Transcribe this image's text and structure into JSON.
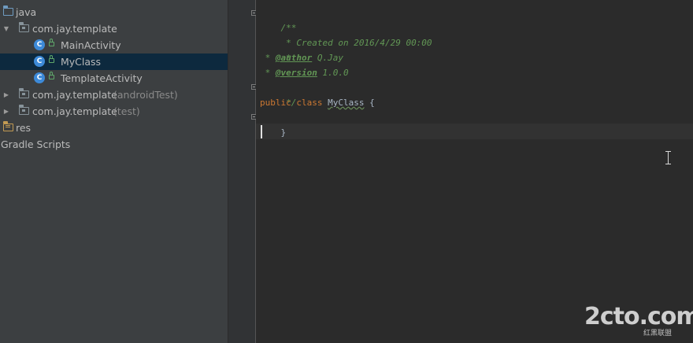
{
  "project_tree": {
    "items": [
      {
        "label": "java",
        "suffix": ""
      },
      {
        "label": "com.jay.template",
        "suffix": ""
      },
      {
        "label": "MainActivity",
        "suffix": "",
        "icon_letter": "C"
      },
      {
        "label": "MyClass",
        "suffix": "",
        "icon_letter": "C"
      },
      {
        "label": "TemplateActivity",
        "suffix": "",
        "icon_letter": "C"
      },
      {
        "label": "com.jay.template",
        "suffix": "(androidTest)"
      },
      {
        "label": "com.jay.template",
        "suffix": "(test)"
      },
      {
        "label": "res",
        "suffix": ""
      },
      {
        "label": "Gradle Scripts",
        "suffix": ""
      }
    ],
    "selected_item": "MyClass"
  },
  "editor": {
    "lines": [
      {
        "c1": "/**"
      },
      {
        "c1": " * Created on 2016/4/29 00:00"
      },
      {
        "c1": " *"
      },
      {
        "c1": " * ",
        "tag": "@author",
        "c2": " Q.Jay"
      },
      {
        "c1": " * ",
        "tag": "@version",
        "c2": " 1.0.0"
      },
      {
        "c1": " */"
      },
      {
        "kw1": "public",
        "kw2": "class",
        "name": "MyClass",
        "brace": "{"
      },
      {
        "brace": "}"
      }
    ]
  },
  "watermark": {
    "main": "2cto.com",
    "sub": "红黑联盟"
  },
  "colors": {
    "tree_background": "#3c3f41",
    "selection": "#0d293e",
    "editor_background": "#2b2b2b",
    "comment": "#629755",
    "keyword": "#cc7832",
    "text": "#a9b7c6",
    "class_icon": "#3d8ad8"
  }
}
